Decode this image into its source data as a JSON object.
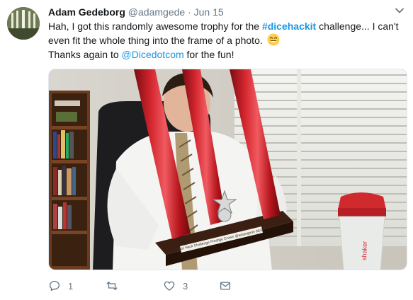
{
  "tweet": {
    "author_name": "Adam Gedeborg",
    "handle": "@adamgede",
    "separator": "·",
    "date": "Jun 15",
    "text_part1": "Hah, I got this randomly awesome trophy for the ",
    "hashtag": "#dicehackit",
    "text_part2": " challenge... I can't even fit the whole thing into the frame of a photo. ",
    "text_part3": "Thanks again to ",
    "mention": "@Dicedotcom",
    "text_part4": " for the fun!",
    "emoji": "smiling-face-emoji",
    "media_alt": "Photo of a man holding a large red trophy in an office",
    "plaque_text": "Dice Hack Challenge Prestige Crown @adamgede 06/15"
  },
  "actions": {
    "reply_count": "1",
    "retweet_count": "",
    "like_count": "3"
  },
  "icons": {
    "reply": "reply-icon",
    "retweet": "retweet-icon",
    "like": "heart-icon",
    "dm": "mail-icon",
    "caret": "chevron-down-icon"
  },
  "colors": {
    "link": "#1b95e0",
    "meta": "#657786",
    "trophy_red": "#c8202a"
  }
}
